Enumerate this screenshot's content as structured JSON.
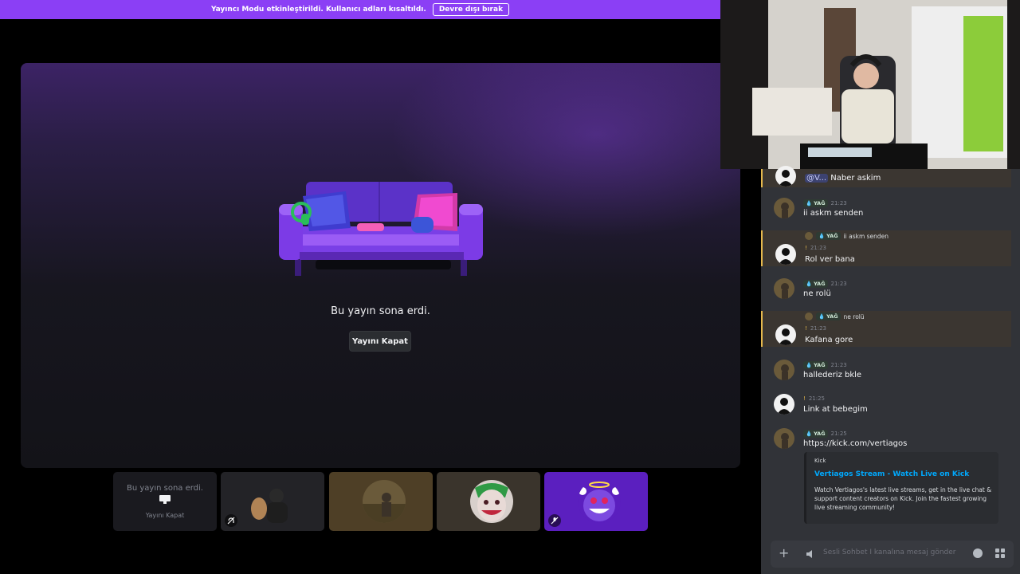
{
  "banner": {
    "text": "Yayıncı Modu etkinleştirildi. Kullanıcı adları kısaltıldı.",
    "button": "Devre dışı bırak"
  },
  "stage": {
    "ended_text": "Bu yayın sona erdi.",
    "close_button": "Yayını Kapat"
  },
  "tiles": {
    "ended_text": "Bu yayın sona erdi.",
    "close_label": "Yayını Kapat"
  },
  "chat": {
    "messages": [
      {
        "mention": "@V...",
        "text": "Naber askim"
      },
      {
        "time": "21:23",
        "tag": "YAĞ",
        "text": "ii askm senden"
      },
      {
        "reply_tag": "YAĞ",
        "reply_text": "ii askm senden",
        "time": "21:23",
        "text": "Rol ver bana"
      },
      {
        "time": "21:23",
        "tag": "YAĞ",
        "text": "ne rolü"
      },
      {
        "reply_tag": "YAĞ",
        "reply_text": "ne rolü",
        "time": "21:23",
        "text": "Kafana gore"
      },
      {
        "time": "21:23",
        "tag": "YAĞ",
        "text": "hallederiz bkle"
      },
      {
        "time": "21:25",
        "text": "Link at bebegim"
      },
      {
        "time": "21:25",
        "tag": "YAĞ",
        "text": "https://kick.com/vertiagos"
      }
    ],
    "embed": {
      "provider": "Kick",
      "title": "Vertiagos Stream - Watch Live on Kick",
      "description": "Watch Vertiagos's latest live streams, get in the live chat & support content creators on Kick. Join the fastest growing live streaming community!"
    },
    "composer": {
      "placeholder": "Sesli Sohbet I kanalına mesaj gönder"
    }
  },
  "colors": {
    "banner": "#8b3ff5",
    "accent_link": "#00a8fc",
    "highlight_border": "#e5b84d"
  }
}
